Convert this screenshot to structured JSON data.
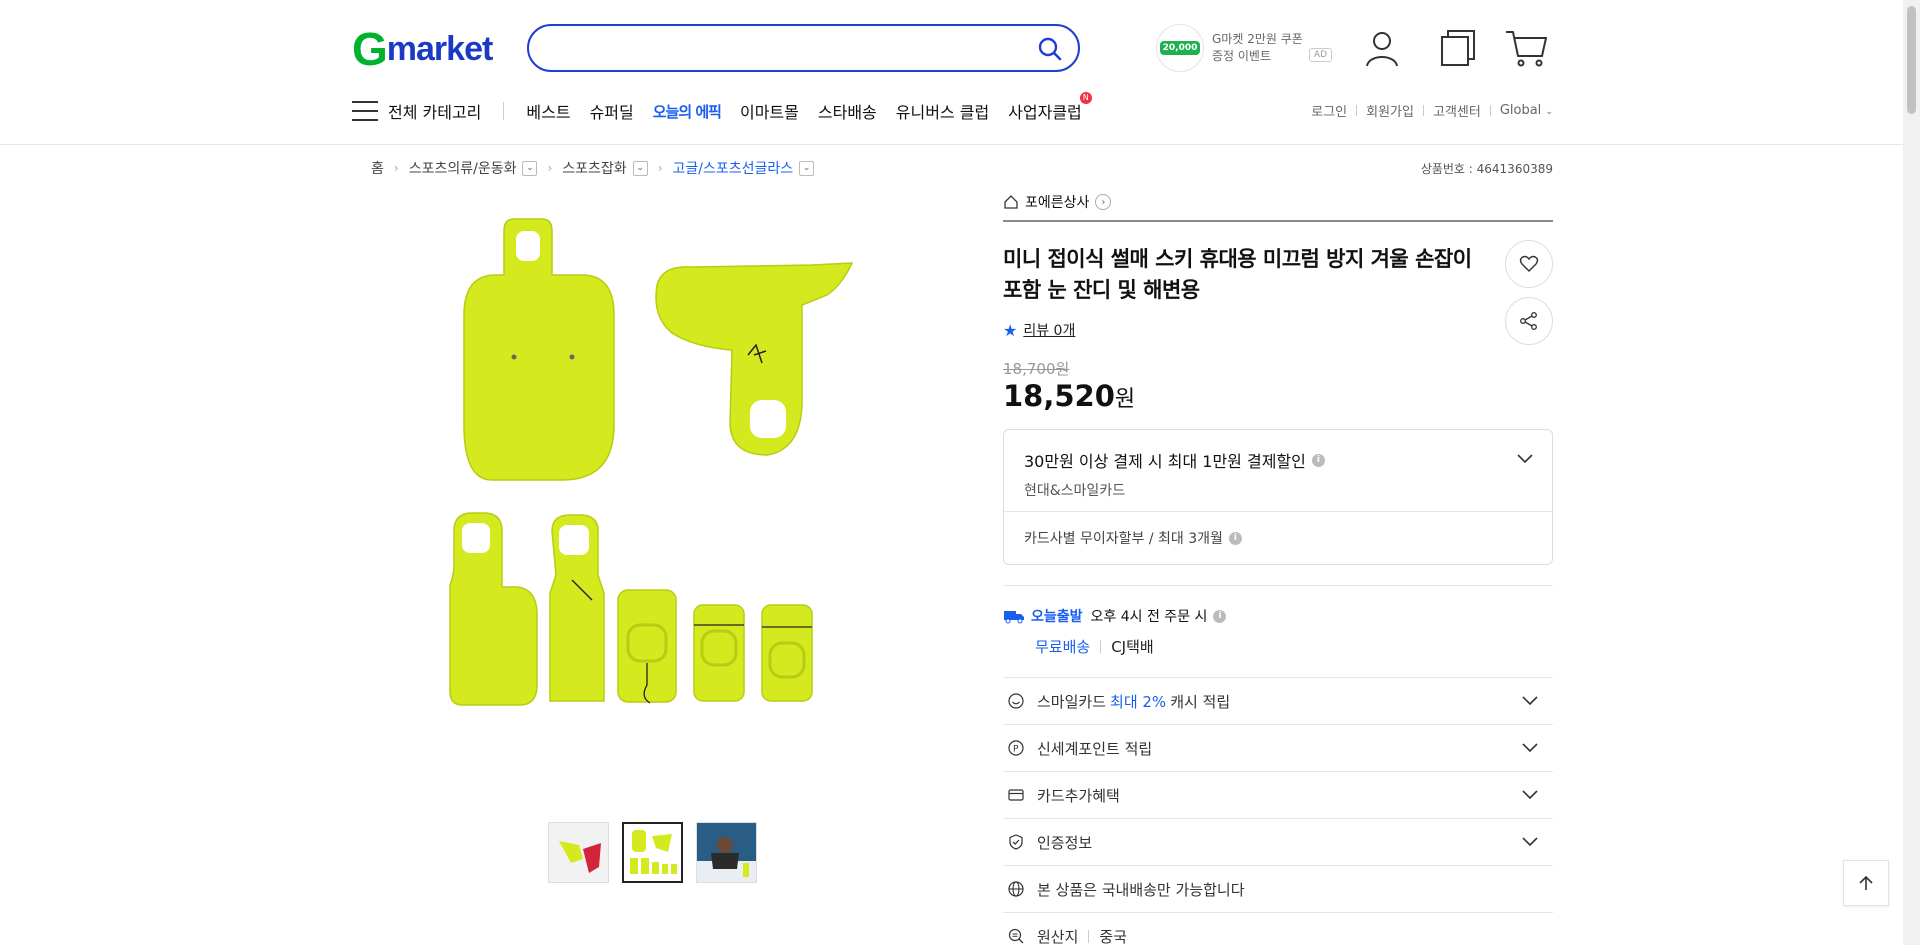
{
  "header": {
    "logo_g": "G",
    "logo_rest": "market",
    "search_placeholder": "",
    "promo": {
      "amount": "20,000",
      "line1": "G마켓 2만원 쿠폰",
      "line2": "증정 이벤트",
      "ad": "AD"
    }
  },
  "gnb": {
    "all_category": "전체 카테고리",
    "items": [
      "베스트",
      "슈퍼딜",
      "오늘의 에픽",
      "이마트몰",
      "스타배송",
      "유니버스 클럽",
      "사업자클럽"
    ],
    "new_badge": "N",
    "util": [
      "로그인",
      "회원가입",
      "고객센터",
      "Global"
    ]
  },
  "breadcrumb": {
    "items": [
      "홈",
      "스포츠의류/운동화",
      "스포츠잡화",
      "고글/스포츠선글라스"
    ],
    "product_no": "상품번호 : 4641360389"
  },
  "product": {
    "seller": "포에른상사",
    "title": "미니 접이식 썰매 스키 휴대용 미끄럼 방지 겨울 손잡이 포함 눈 잔디 및 해변용",
    "review": "리뷰 0개",
    "original_price": "18,700원",
    "price": "18,520",
    "price_unit": "원"
  },
  "card_benefit": {
    "title": "30만원 이상 결제 시 최대 1만원 결제할인",
    "card": "현대&스마일카드",
    "installment": "카드사별 무이자할부 / 최대 3개월"
  },
  "shipping": {
    "today_label": "오늘출발",
    "condition": "오후 4시 전 주문 시",
    "free": "무료배송",
    "courier": "CJ택배"
  },
  "accordion": {
    "smilecard_pre": "스마일카드",
    "smilecard_hl": "최대 2%",
    "smilecard_post": "캐시 적립",
    "shinsegae": "신세계포인트 적립",
    "card_extra": "카드추가혜택",
    "cert": "인증정보",
    "domestic": "본 상품은 국내배송만 가능합니다",
    "origin_label": "원산지",
    "origin_value": "중국"
  },
  "colors": {
    "brand_green": "#00b22d",
    "brand_blue": "#1a3ac6",
    "accent": "#1a5ef0",
    "product_yellow": "#d4ea1f"
  }
}
